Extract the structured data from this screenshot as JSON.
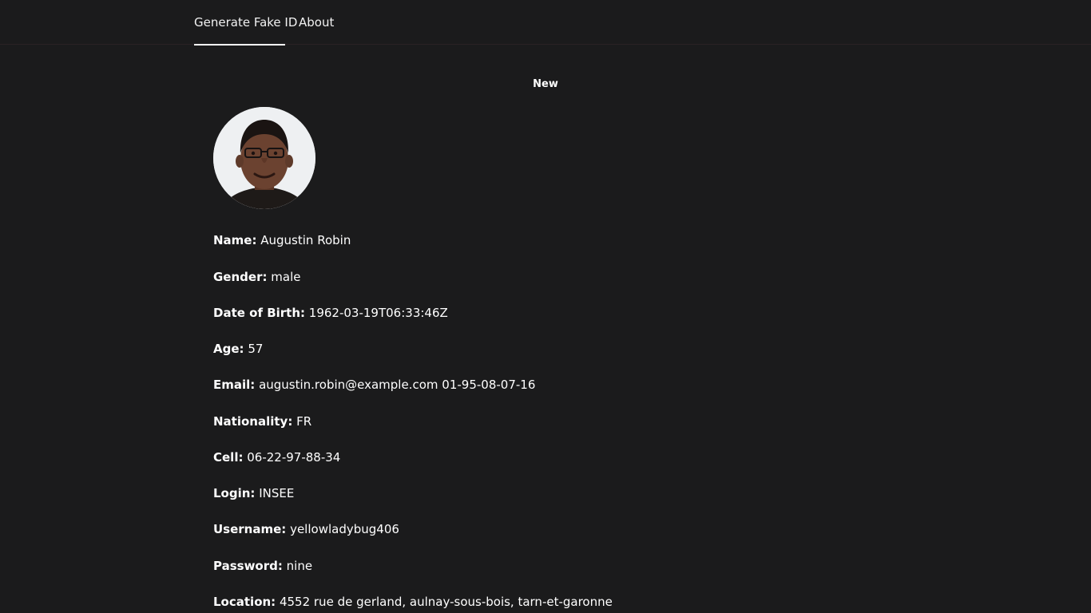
{
  "nav": {
    "tabs": [
      {
        "label": "Generate Fake ID",
        "active": true
      },
      {
        "label": "About",
        "active": false
      }
    ]
  },
  "actions": {
    "new_label": "New"
  },
  "profile": {
    "avatar_icon": "person-photo",
    "fields": [
      {
        "label": "Name:",
        "value": "Augustin Robin"
      },
      {
        "label": "Gender:",
        "value": "male"
      },
      {
        "label": "Date of Birth:",
        "value": "1962-03-19T06:33:46Z"
      },
      {
        "label": "Age:",
        "value": "57"
      },
      {
        "label": "Email:",
        "value": "augustin.robin@example.com 01-95-08-07-16"
      },
      {
        "label": "Nationality:",
        "value": "FR"
      },
      {
        "label": "Cell:",
        "value": "06-22-97-88-34"
      },
      {
        "label": "Login:",
        "value": "INSEE"
      },
      {
        "label": "Username:",
        "value": "yellowladybug406"
      },
      {
        "label": "Password:",
        "value": "nine"
      },
      {
        "label": "Location:",
        "value": "4552 rue de gerland, aulnay-sous-bois, tarn-et-garonne"
      }
    ]
  },
  "colors": {
    "background": "#1b1b1c",
    "text": "#ffffff",
    "active_tab_underline": "#ffffff"
  }
}
